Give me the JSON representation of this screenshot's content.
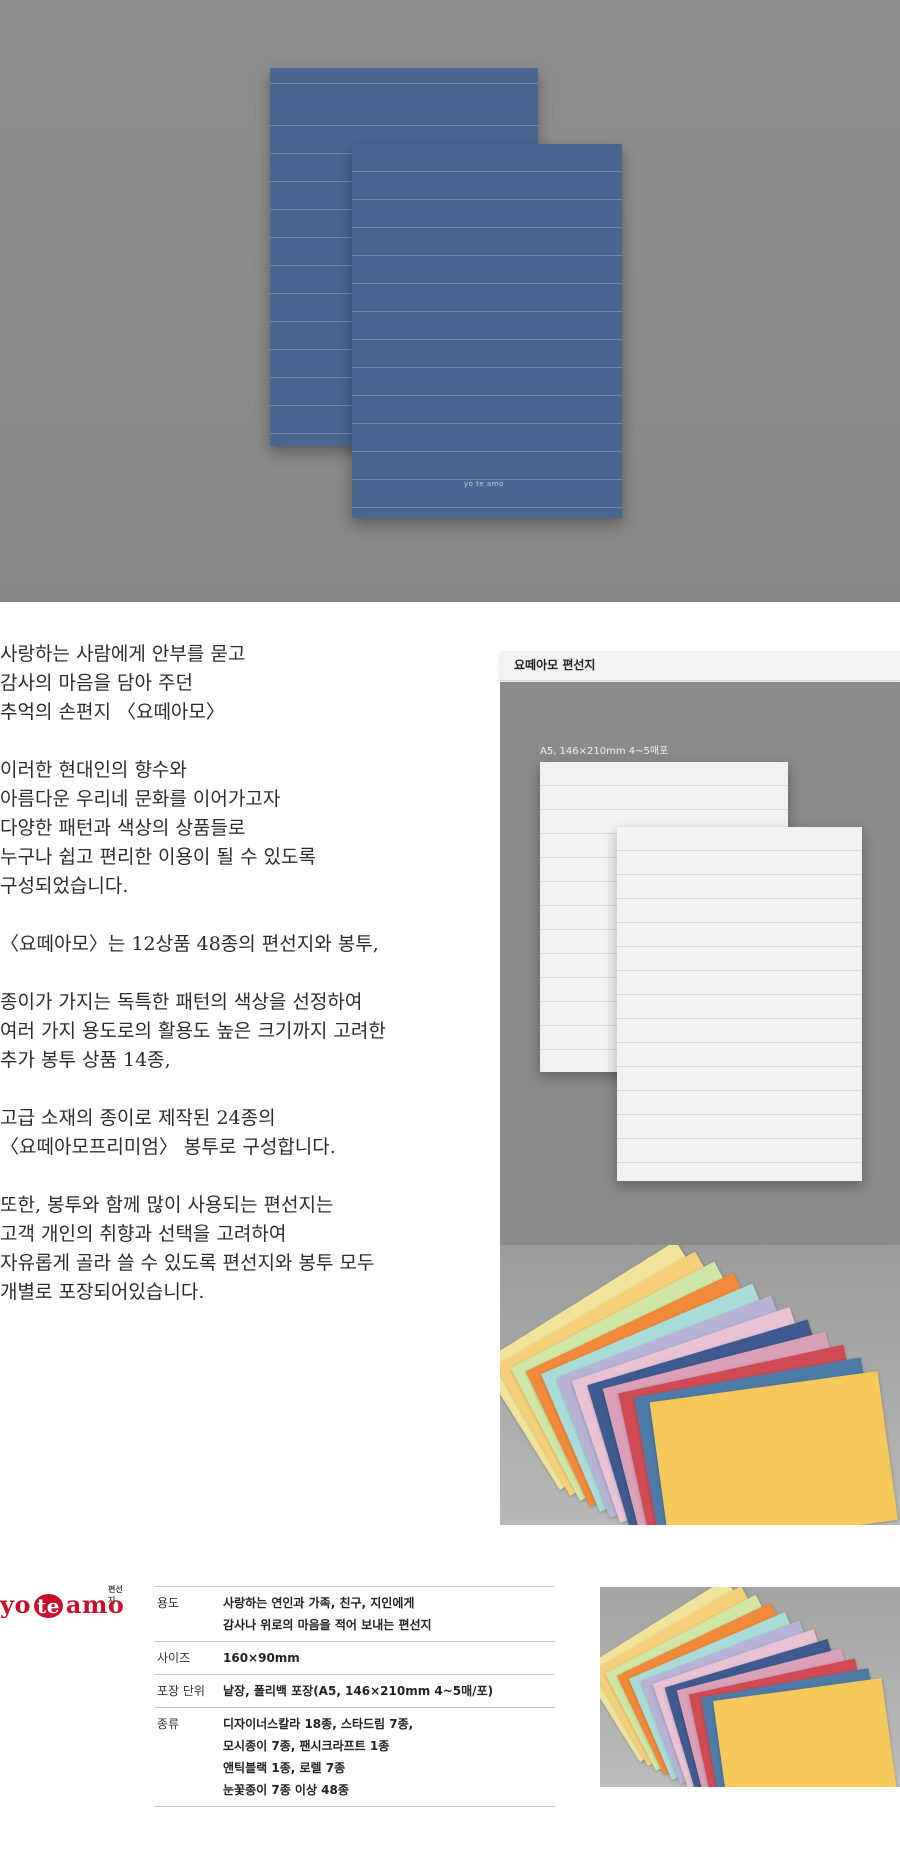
{
  "hero": {
    "sheet_brand": "yo te amo"
  },
  "intro": {
    "paragraphs": [
      "사랑하는 사람에게 안부를 묻고\n감사의 마음을 담아 주던\n추억의 손편지 〈요떼아모〉",
      "이러한 현대인의 향수와\n아름다운 우리네 문화를 이어가고자\n다양한 패턴과 색상의 상품들로\n누구나 쉽고 편리한 이용이 될 수 있도록\n구성되었습니다.",
      "〈요떼아모〉는 12상품 48종의 편선지와 봉투,",
      "종이가 가지는 독특한 패턴의 색상을 선정하여\n여러 가지 용도로의 활용도 높은 크기까지 고려한\n추가 봉투 상품 14종,",
      "고급 소재의 종이로 제작된 24종의\n〈요떼아모프리미엄〉 봉투로 구성합니다.",
      "또한, 봉투와 함께 많이 사용되는 편선지는\n고객 개인의 취향과 선택을 고려하여\n자유롭게 골라 쓸 수 있도록 편선지와 봉투 모두\n개별로 포장되어있습니다."
    ]
  },
  "side": {
    "header": "요떼아모 편선지",
    "caption": "A5, 146×210mm 4~5매포"
  },
  "logo": {
    "part1": "yo",
    "part2": "te",
    "part3": "amo",
    "sub": "편선지"
  },
  "spec": [
    {
      "key": "용도",
      "value": "사랑하는 연인과 가족, 친구, 지인에게\n감사나 위로의 마음을 적어 보내는 편선지"
    },
    {
      "key": "사이즈",
      "value": "160×90mm"
    },
    {
      "key": "포장 단위",
      "value": "낱장, 폴리백 포장(A5, 146×210mm 4~5매/포)"
    },
    {
      "key": "종류",
      "value": "디자이너스칼라 18종, 스타드림 7종,\n모시종이 7종, 팬시크라프트 1종\n앤틱블랙 1종, 로렐 7종\n눈꽃종이 7종 이상 48종"
    }
  ],
  "colors": {
    "hero_bg": "#8b8b89",
    "blue_paper": "#4a6791",
    "brand_red": "#c8102e",
    "fan_papers": [
      "#f1e39a",
      "#f6cf7a",
      "#cfe6a6",
      "#f08a3a",
      "#a9dcd8",
      "#b7b2d6",
      "#e9c2d4",
      "#3e5a8f",
      "#d9a0b8",
      "#cf4a52",
      "#4e7aa8",
      "#f5c85a"
    ]
  }
}
